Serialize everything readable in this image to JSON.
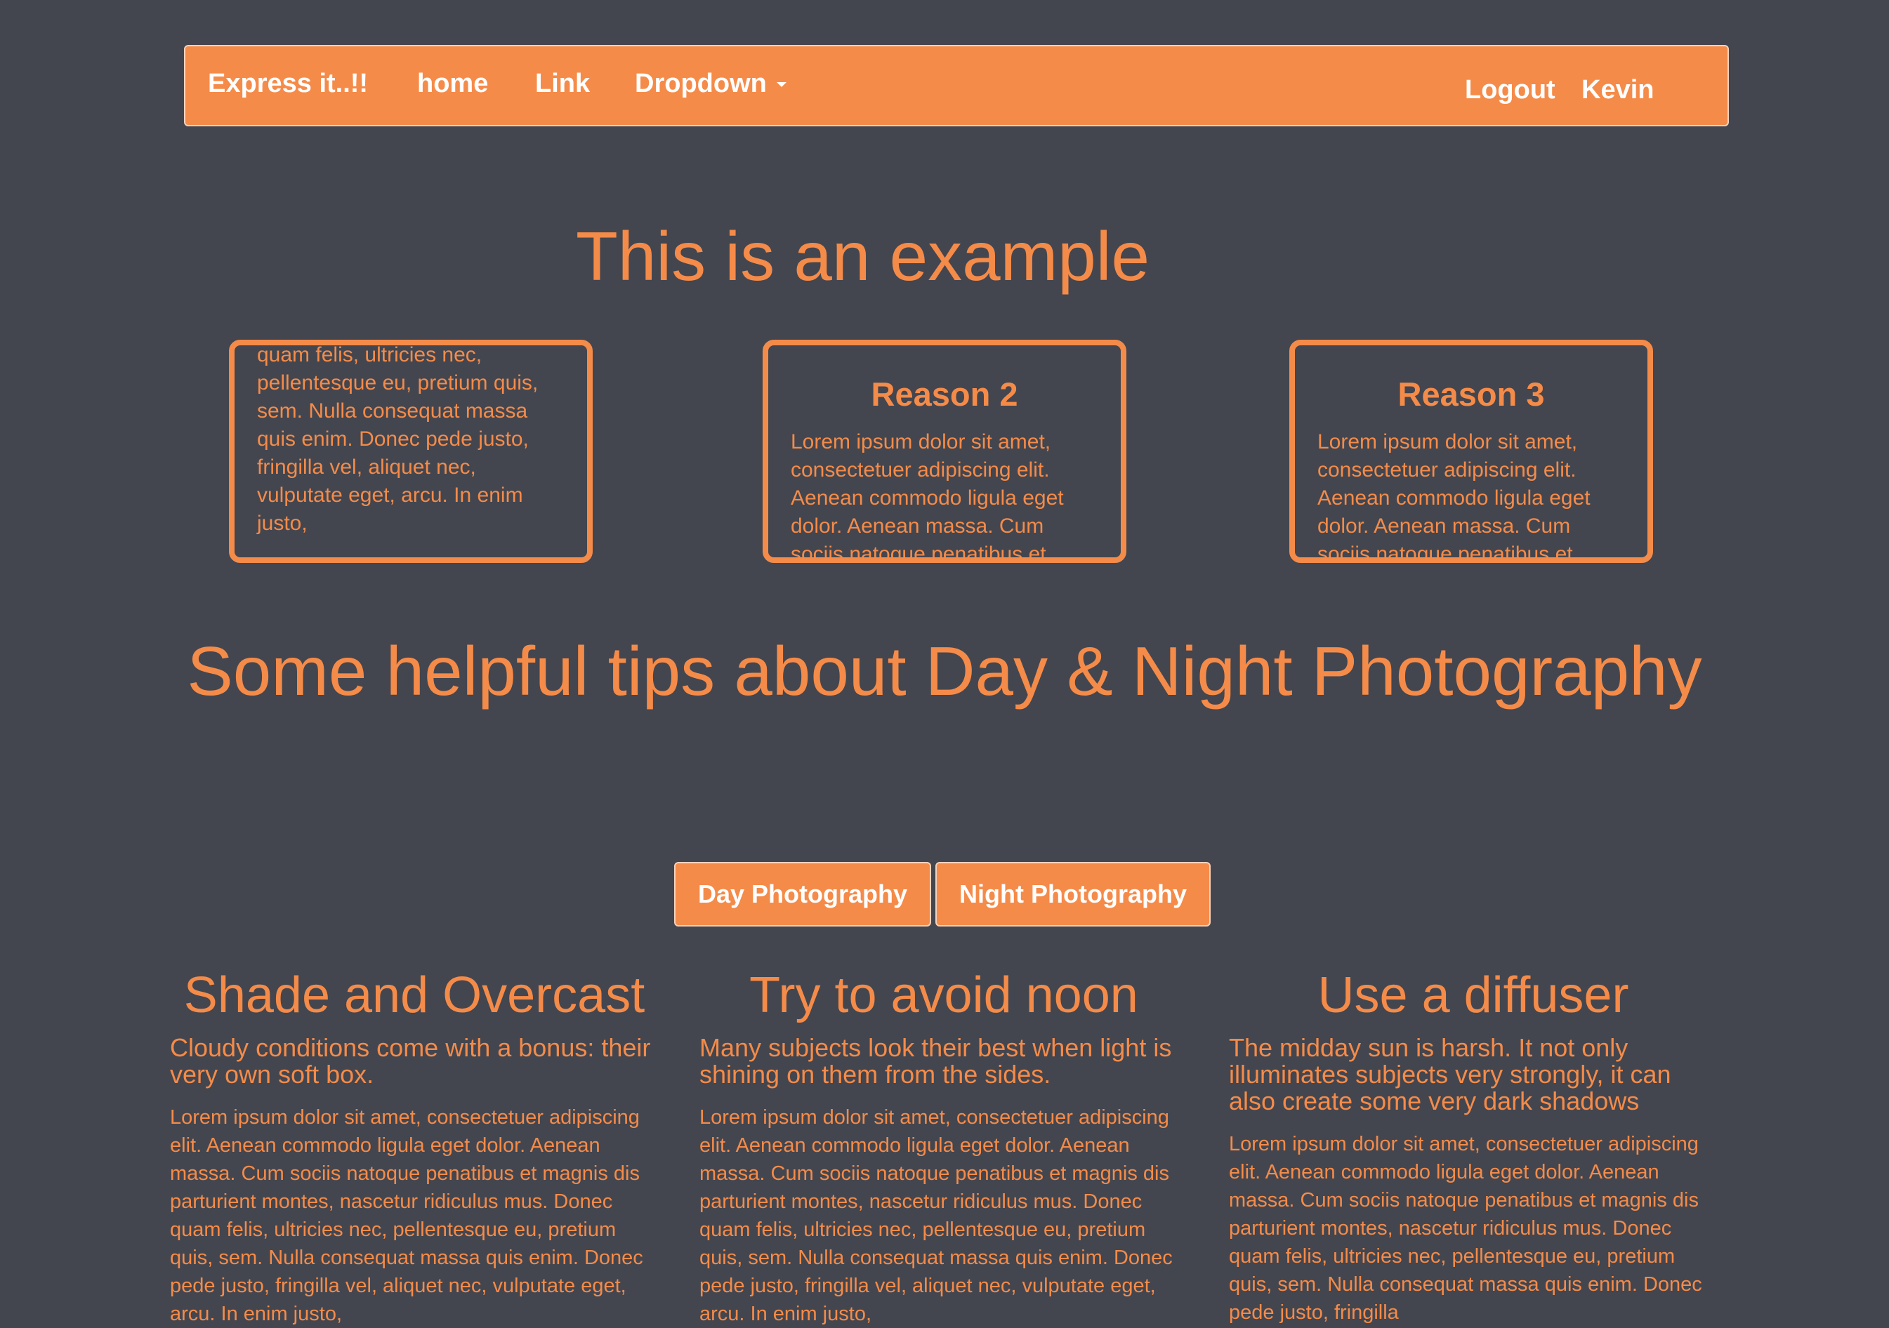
{
  "navbar": {
    "brand": "Express it..!!",
    "links": [
      "home",
      "Link"
    ],
    "dropdown_label": "Dropdown",
    "logout_label": "Logout",
    "user_name": "Kevin"
  },
  "hero": {
    "title": "This is an example"
  },
  "reasons": [
    {
      "title": "",
      "text": "Lorem ipsum dolor sit amet, consectetuer adipiscing elit. Aenean commodo ligula eget dolor. Aenean massa. Cum sociis natoque penatibus et magnis dis parturient montes, nascetur ridiculus mus. Donec quam felis, ultricies nec, pellentesque eu, pretium quis, sem. Nulla consequat massa quis enim. Donec pede justo, fringilla vel, aliquet nec, vulputate eget, arcu. In enim justo,"
    },
    {
      "title": "Reason 2",
      "text": "Lorem ipsum dolor sit amet, consectetuer adipiscing elit. Aenean commodo ligula eget dolor. Aenean massa. Cum sociis natoque penatibus et magnis dis"
    },
    {
      "title": "Reason 3",
      "text": "Lorem ipsum dolor sit amet, consectetuer adipiscing elit. Aenean commodo ligula eget dolor. Aenean massa. Cum sociis natoque penatibus et magnis dis"
    }
  ],
  "tips": {
    "title": "Some helpful tips about Day & Night Photography",
    "tab_day": "Day Photography",
    "tab_night": "Night Photography",
    "columns": [
      {
        "title": "Shade and Overcast",
        "lead": "Cloudy conditions come with a bonus: their very own soft box.",
        "text": "Lorem ipsum dolor sit amet, consectetuer adipiscing elit. Aenean commodo ligula eget dolor. Aenean massa. Cum sociis natoque penatibus et magnis dis parturient montes, nascetur ridiculus mus. Donec quam felis, ultricies nec, pellentesque eu, pretium quis, sem. Nulla consequat massa quis enim. Donec pede justo, fringilla vel, aliquet nec, vulputate eget, arcu. In enim justo,"
      },
      {
        "title": "Try to avoid noon",
        "lead": "Many subjects look their best when light is shining on them from the sides.",
        "text": "Lorem ipsum dolor sit amet, consectetuer adipiscing elit. Aenean commodo ligula eget dolor. Aenean massa. Cum sociis natoque penatibus et magnis dis parturient montes, nascetur ridiculus mus. Donec quam felis, ultricies nec, pellentesque eu, pretium quis, sem. Nulla consequat massa quis enim. Donec pede justo, fringilla vel, aliquet nec, vulputate eget, arcu. In enim justo,"
      },
      {
        "title": "Use a diffuser",
        "lead": "The midday sun is harsh. It not only illuminates subjects very strongly, it can also create some very dark shadows",
        "text": "Lorem ipsum dolor sit amet, consectetuer adipiscing elit. Aenean commodo ligula eget dolor. Aenean massa. Cum sociis natoque penatibus et magnis dis parturient montes, nascetur ridiculus mus. Donec quam felis, ultricies nec, pellentesque eu, pretium quis, sem. Nulla consequat massa quis enim. Donec pede justo, fringilla"
      }
    ]
  },
  "colors": {
    "background": "#43464f",
    "accent": "#f58b49",
    "text_on_accent": "#ffffff",
    "border_light": "#f3d2bd"
  }
}
